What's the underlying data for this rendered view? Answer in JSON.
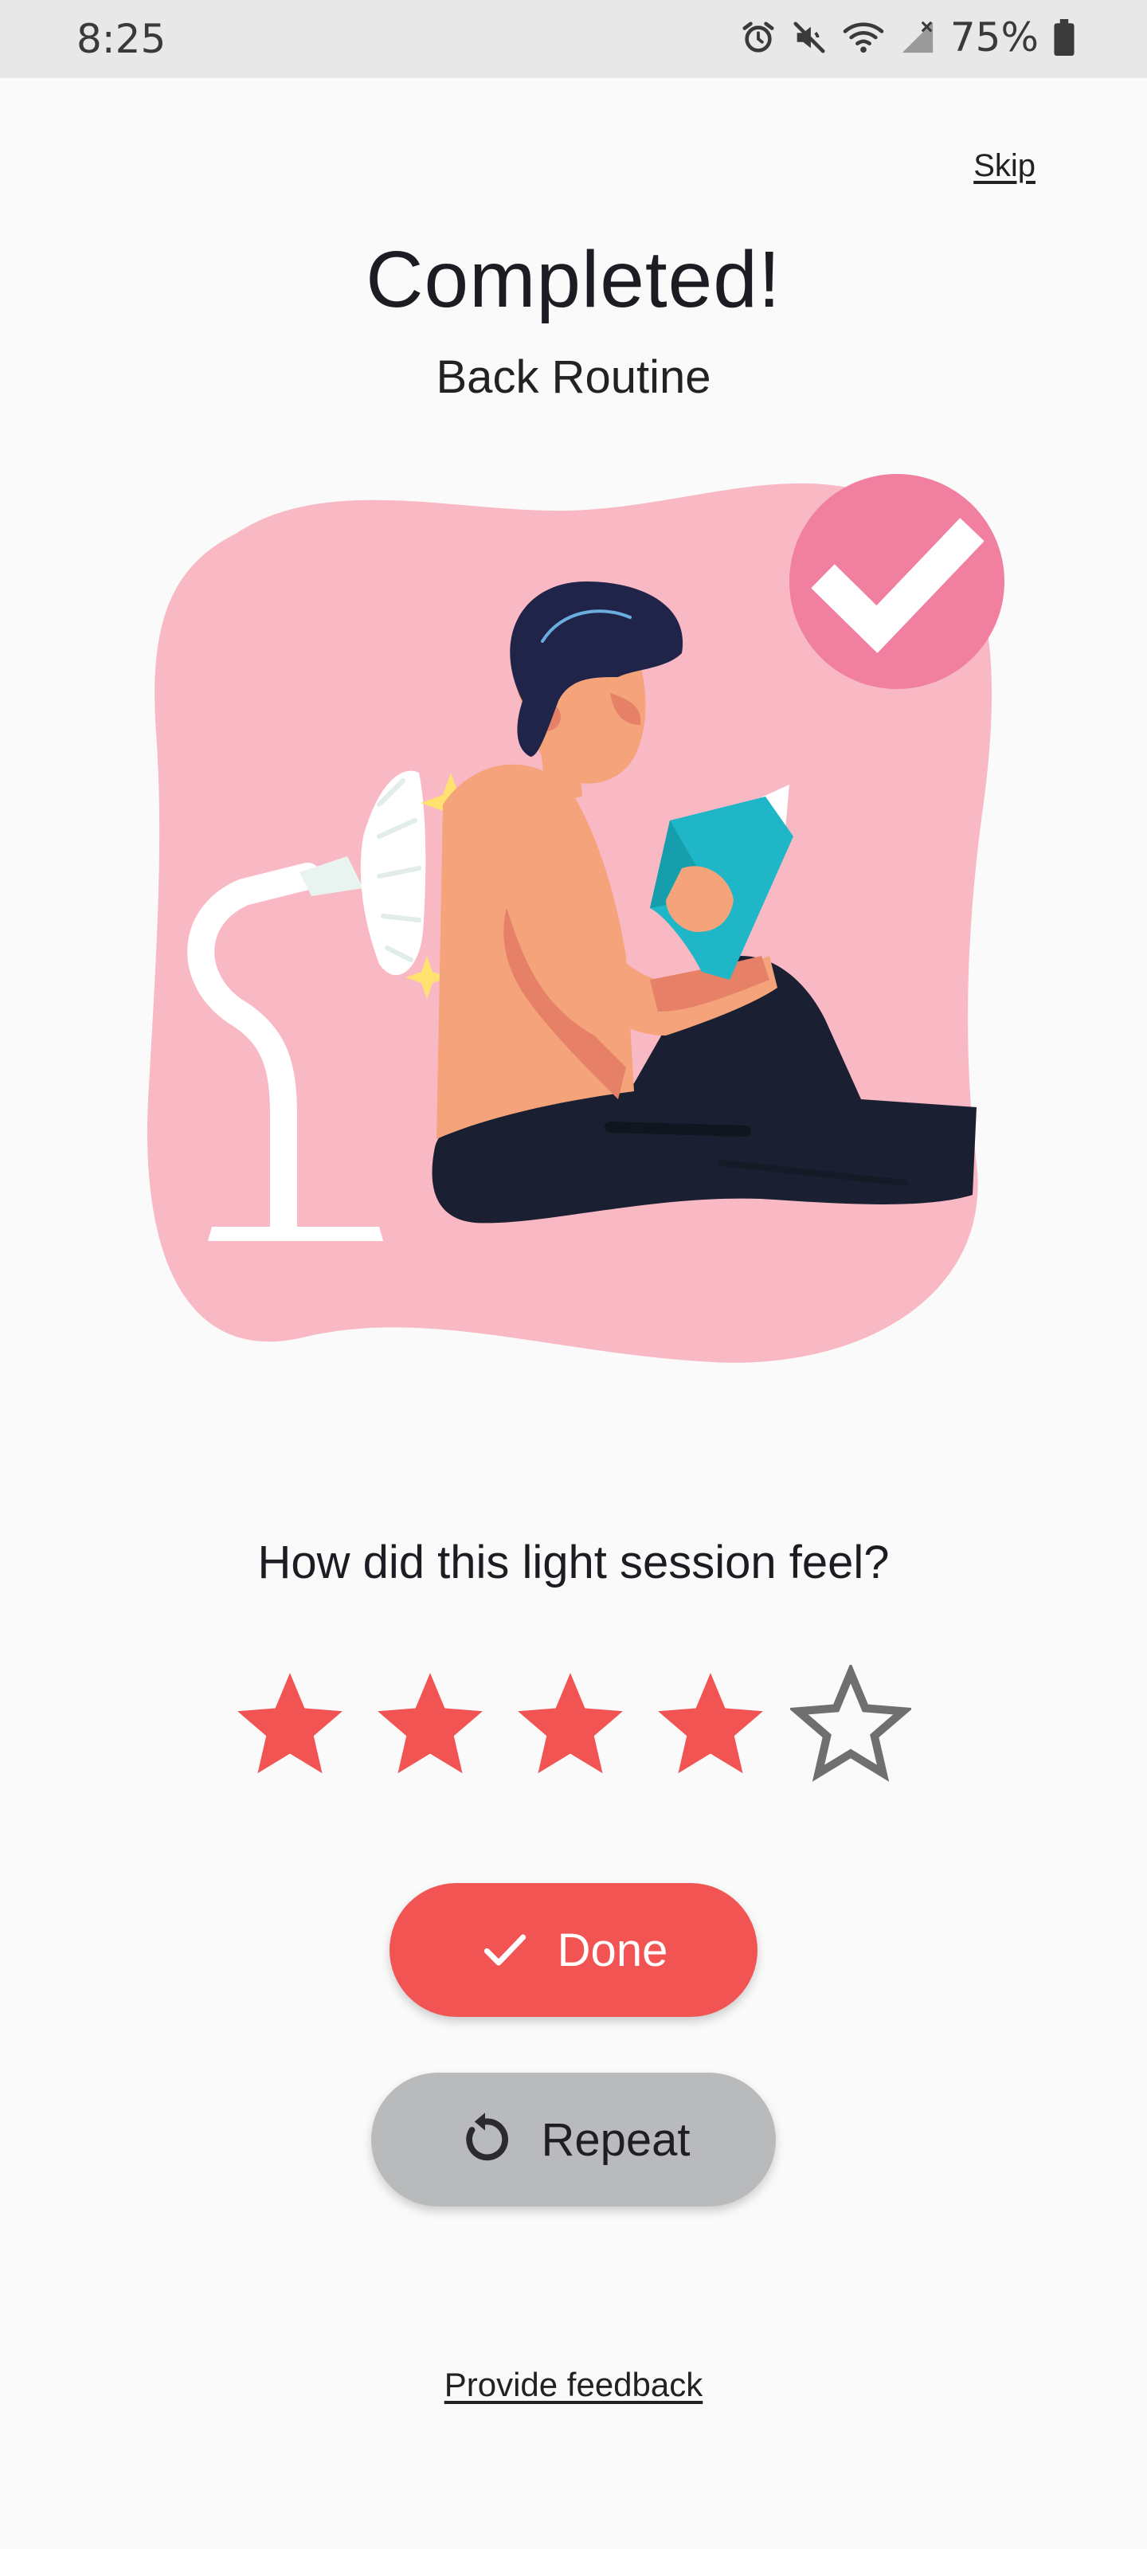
{
  "status_bar": {
    "time": "8:25",
    "battery_percent": "75%",
    "icons": [
      "alarm-icon",
      "mute-icon",
      "wifi-icon",
      "cell-signal-icon",
      "battery-icon"
    ]
  },
  "header": {
    "skip_label": "Skip",
    "title": "Completed!",
    "subtitle": "Back Routine"
  },
  "illustration": {
    "description_icon": "person-reading-under-lamp-illustration",
    "check_badge_color": "#f07fa0",
    "blob_color": "#f9b9c4"
  },
  "rating": {
    "question": "How did this light session feel?",
    "value": 4,
    "max": 5,
    "filled_color": "#f15452",
    "empty_color": "#6f6f6f"
  },
  "actions": {
    "done_label": "Done",
    "repeat_label": "Repeat",
    "feedback_label": "Provide feedback"
  },
  "colors": {
    "background": "#fafafa",
    "primary": "#f15452",
    "secondary": "#b8babc"
  }
}
